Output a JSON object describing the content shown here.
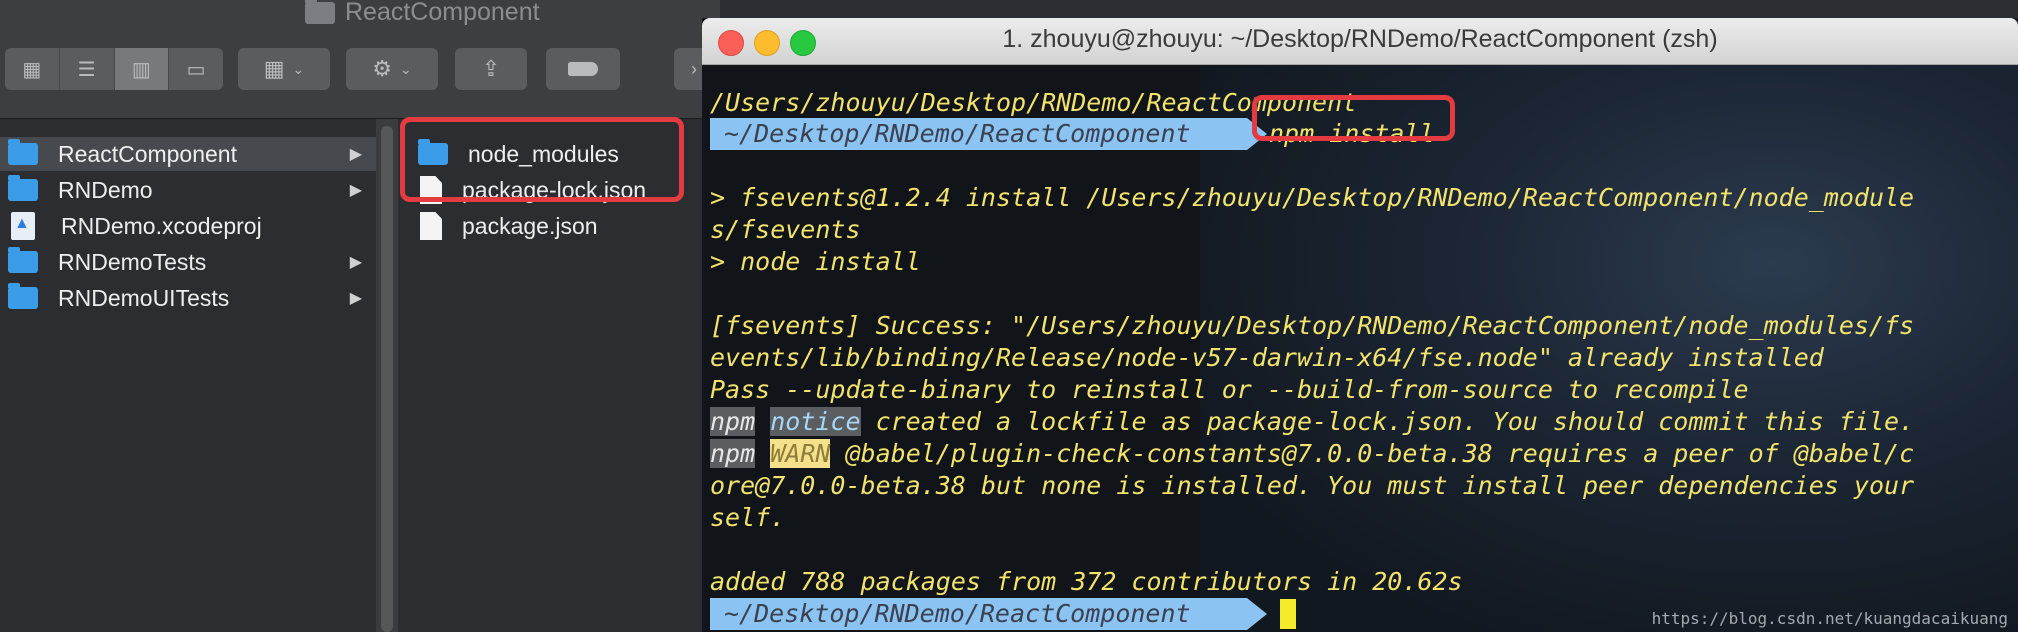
{
  "finder": {
    "title": "ReactComponent",
    "toolbar": {
      "view_icons": [
        "icon-view-icon",
        "list-view-icon",
        "column-view-icon",
        "gallery-view-icon"
      ],
      "group_icon": "group-grid-icon",
      "action_icon": "gear-icon",
      "share_icon": "share-icon",
      "tag_icon": "tag-icon"
    },
    "sidebar_items": [
      {
        "label": "ReactComponent",
        "type": "folder",
        "has_arrow": true
      },
      {
        "label": "RNDemo",
        "type": "folder",
        "has_arrow": true
      },
      {
        "label": "RNDemo.xcodeproj",
        "type": "xcodeproj",
        "has_arrow": false
      },
      {
        "label": "RNDemoTests",
        "type": "folder",
        "has_arrow": true
      },
      {
        "label": "RNDemoUITests",
        "type": "folder",
        "has_arrow": true
      }
    ],
    "files": [
      {
        "label": "node_modules",
        "type": "folder"
      },
      {
        "label": "package-lock.json",
        "type": "file"
      },
      {
        "label": "package.json",
        "type": "file"
      }
    ]
  },
  "terminal": {
    "title": "1. zhouyu@zhouyu: ~/Desktop/RNDemo/ReactComponent (zsh)",
    "cwd_line": "/Users/zhouyu/Desktop/RNDemo/ReactComponent",
    "prompt_path": "~/Desktop/RNDemo/ReactComponent",
    "command": "npm install",
    "output": {
      "l1": "> fsevents@1.2.4 install /Users/zhouyu/Desktop/RNDemo/ReactComponent/node_module",
      "l2": "s/fsevents",
      "l3": "> node install",
      "l4": "[fsevents] Success: \"/Users/zhouyu/Desktop/RNDemo/ReactComponent/node_modules/fs",
      "l5": "events/lib/binding/Release/node-v57-darwin-x64/fse.node\" already installed",
      "l6": "Pass --update-binary to reinstall or --build-from-source to recompile",
      "l7_npm": "npm",
      "l7_tag": "notice",
      "l7_rest": " created a lockfile as package-lock.json. You should commit this file.",
      "l8_npm": "npm",
      "l8_tag": "WARN",
      "l8_rest": " @babel/plugin-check-constants@7.0.0-beta.38 requires a peer of @babel/c",
      "l9": "ore@7.0.0-beta.38 but none is installed. You must install peer dependencies your",
      "l10": "self.",
      "l11": "added 788 packages from 372 contributors in 20.62s"
    },
    "watermark": "https://blog.csdn.net/kuangdacaikuang"
  },
  "colors": {
    "highlight_box": "#e33b3f",
    "prompt_bar": "#8bc3f2",
    "terminal_text": "#f2e36c",
    "cursor": "#f4ec2a",
    "folder_blue": "#3b9de9"
  }
}
